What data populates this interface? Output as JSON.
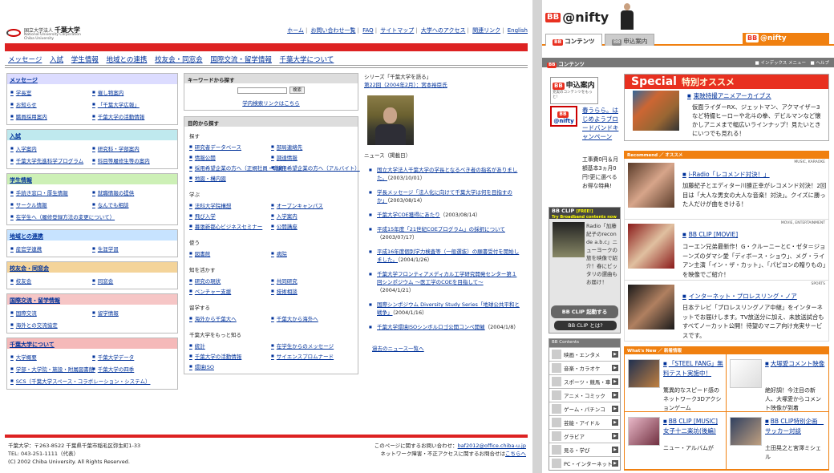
{
  "chiba": {
    "logo": {
      "line1_small": "国立大学法人",
      "line1": "千葉大学",
      "line2a": "National University Corporation",
      "line2b": "Chiba University"
    },
    "topnav": [
      "ホーム",
      "お問い合わせ一覧",
      "FAQ",
      "サイトマップ",
      "大学へのアクセス",
      "関連リンク",
      "English"
    ],
    "mainnav": [
      "メッセージ",
      "入試",
      "学生情報",
      "地域との連携",
      "校友会・同窓会",
      "国際交流・留学情報",
      "千葉大学について"
    ],
    "sidebar": [
      {
        "title": "メッセージ",
        "color": "#dcdcff",
        "items": [
          "学長室",
          "催し物案内",
          "お知らせ",
          "「千葉大学広報」",
          "職員採用案内",
          "千葉大学の活動情報"
        ]
      },
      {
        "title": "入試",
        "color": "#bfe9ee",
        "items": [
          "入学案内",
          "研究科・学部案内",
          "千葉大学先進科学プログラム",
          "",
          "科目等履修生等の案内",
          ""
        ]
      },
      {
        "title": "学生情報",
        "color": "#cdf0b6",
        "items": [
          "手続き窓口・厚生情報",
          "就職情報の提供",
          "サークル情報",
          "なんでも相談",
          "在学生へ（履修登録方法の変更について）",
          ""
        ]
      },
      {
        "title": "地域との連携",
        "color": "#c7e3ff",
        "items": [
          "産官学連携",
          "生涯学習"
        ]
      },
      {
        "title": "校友会・同窓会",
        "color": "#f4d49a",
        "items": [
          "校友会",
          "同窓会"
        ]
      },
      {
        "title": "国際交流・留学情報",
        "color": "#f6c6c6",
        "items": [
          "国際交流",
          "留学情報",
          "海外との交流協定",
          ""
        ]
      },
      {
        "title": "千葉大学について",
        "color": "#f5b9b9",
        "items": [
          "大学概要",
          "千葉大学データ",
          "学部・大学院・施設・附属図書館",
          "千葉大学の四季",
          "SCS（千葉大学スペース・コラボレーション・システム）",
          ""
        ]
      }
    ],
    "keyword": {
      "title": "キーワードから探す",
      "button": "検索",
      "link": "学内検索リンクはこちら"
    },
    "purpose": {
      "title": "目的から探す",
      "sections": [
        {
          "label": "探す",
          "items": [
            "研究者データベース",
            "部局連絡先",
            "情報公開",
            "調達情報",
            "採用希望企業の方へ（正規社員・職員）",
            "採用希望企業の方へ（アルバイト）",
            "地図・構内図",
            ""
          ]
        },
        {
          "label": "学ぶ",
          "items": [
            "法科大学院構想",
            "オープンキャンパス",
            "飛び入学",
            "入学案内",
            "幕張新都心ビジネスセミナー",
            "公開講座"
          ]
        },
        {
          "label": "使う",
          "items": [
            "図書館",
            "病院"
          ]
        },
        {
          "label": "知を活かす",
          "items": [
            "研究の現状",
            "共同研究",
            "ベンチャー支援",
            "技術相談"
          ]
        },
        {
          "label": "留学する",
          "items": [
            "海外から千葉大へ",
            "千葉大から海外へ"
          ]
        },
        {
          "label": "千葉大学をもっと知る",
          "items": [
            "統計",
            "在学生からのメッセージ",
            "千葉大学の活動情報",
            "サイエンスプロムナード",
            "環境ISO",
            ""
          ]
        }
      ]
    },
    "series": {
      "title": "シリーズ「千葉大学を語る」",
      "issue": "第22回（2004年2月）：宮本裕臣氏"
    },
    "news": {
      "title": "ニュース（掲載日）",
      "items": [
        {
          "t": "国立大学法人千葉大学の学長となるべき者の指名がありました。",
          "d": "（2003/10/01）"
        },
        {
          "t": "学長メッセージ「法人化に向けて千葉大学は何を目指すのか」",
          "d": "（2003/08/14）"
        },
        {
          "t": "千葉大学COE獲得にあたり",
          "d": "（2003/08/14）"
        },
        {
          "t": "平成15年度「21世紀COEプログラム」の採択について",
          "d": "（2003/07/17）"
        },
        {
          "t": "平成16年度個別学力検査等（一般選抜）の願書受付を開始しました。",
          "d": "（2004/1/26）"
        },
        {
          "t": "千葉大学フロンティアメディカル工学研究開発センター第１回シンポジウム 〜医工学のCOEを目指して〜",
          "d": "（2004/1/21）"
        },
        {
          "t": "国際シンポジウム Diversity Study Series「地球公共平和と戦争」",
          "d": "（2004/1/16）"
        },
        {
          "t": "千葉大学環境ISOシンボルロゴ公開コンペ開催",
          "d": "（2004/1/8）"
        }
      ],
      "more": "過去のニュース一覧へ"
    },
    "footer": {
      "addr1": "千葉大学：〒263-8522 千葉県千葉市稲毛区弥生町1-33",
      "addr2": "TEL: 043-251-1111（代表）",
      "copy": "(C) 2002 Chiba University. All Rights Reserved.",
      "contact_label": "このページに関するお問い合わせ：",
      "contact_mail": "baf2012@office.chiba-u.jp",
      "network": "ネットワーク障害・不正アクセスに関するお問合せは",
      "network_link": "こちらへ"
    }
  },
  "nifty": {
    "logo": "@nifty",
    "tabs": [
      "コンテンツ",
      "申込案内"
    ],
    "header": {
      "title": "コンテンツ",
      "right": "■ インデックス メニュー　■ ヘルプ"
    },
    "ad": {
      "title": "申込案内",
      "sub": "充実のコンテンツをもっと!",
      "badge": "@nifty"
    },
    "spring": "春うらら。はじめようブロードバンドキャンペーン",
    "fee": "工事費0円＆月額基本3ヵ月0円!更に選べるお得な特典!",
    "clip": {
      "title": "BB CLIP",
      "free": "[FREE!]",
      "sub": "Try Broadband contents now",
      "text": "Radio「加藤紀子のrecon de a.b.c」ニューヨークの旅を映像で紹介！春にピッタリの選曲もお届け！",
      "btn1": "BB CLIP 起動する",
      "btn2": "BB CLIP とは?"
    },
    "contents": {
      "title": "BB Contents",
      "items": [
        "映画・エンタメ",
        "音楽・カラオケ",
        "スポーツ・競馬・車",
        "アニメ・コミック",
        "ゲーム・パチンコ",
        "芸能・アイドル",
        "グラビア",
        "見る・学び",
        "PC・インターネット"
      ]
    },
    "special": {
      "title": "Special",
      "jp": "特別オススメ",
      "item_title": "東映特撮アニメアーカイブス",
      "item_desc": "仮面ライダーRX、ジェットマン、アクマイザー3など特撮ヒーローや北斗の拳、デビルマンなど懐かしアニメまで幅広いラインナップ！見たいときにいつでも見れる！"
    },
    "recommend": {
      "title": "Recommend ／ オススメ",
      "items": [
        {
          "cat": "MUSIC, KARAOKE",
          "title": "i-Radio「レコメンド対決！」",
          "desc": "加藤紀子とエディター川勝正幸がレコメンド対決！2回目は「大人な男女の大人な音楽！対決」。クイズに勝った人だけが曲をきける！",
          "c1": "#5a3c2a",
          "c2": "#d7a58a"
        },
        {
          "cat": "MOVIE, ENTERTAINMENT",
          "title": "BB CLIP [MOVIE]",
          "desc": "コーエン兄弟最新作！G・クルーニーとC・ゼタ＝ジョーンズのダマシ愛「ディボース・ショウ」、メグ・ライアン主演「イン・ザ・カット」、「パピヨンの贈りもの」を映像でご紹介！",
          "c1": "#8a1a1a",
          "c2": "#e0c0a0"
        },
        {
          "cat": "SPORTS",
          "title": "インターネット・プロレスリング・ノア",
          "desc": "日本テレビ「プロレスリングノア中継」をインターネットでお届けします。TV放送分に加え、未放送試合もすべてノーカット公開！待望のマニア向け充実サービスです。",
          "c1": "#1a1a1a",
          "c2": "#b08060"
        }
      ]
    },
    "whatsnew": {
      "title": "What's New ／ 新着情報",
      "items": [
        {
          "title": "「STEEL FANG」無料テスト実施中！",
          "desc": "驚異的なスピード感のネットワーク3Dアクションゲーム",
          "c1": "#203050",
          "c2": "#c08040"
        },
        {
          "title": "大塚愛コメント映像",
          "desc": "絶好調！今注目の新人、大塚愛からコメント映像が到着",
          "c1": "#ffffff",
          "c2": "#dddddd"
        },
        {
          "title": "BB CLIP [MUSIC] 女子十二楽坊(後編)",
          "desc": "ニュー・アルバムが",
          "c1": "#e9b8c8",
          "c2": "#703040"
        },
        {
          "title": "BB CLIP特別企画　サッカー対談",
          "desc": "土田晃之と宮澤ミシェル",
          "c1": "#304060",
          "c2": "#c0a080"
        }
      ]
    }
  }
}
